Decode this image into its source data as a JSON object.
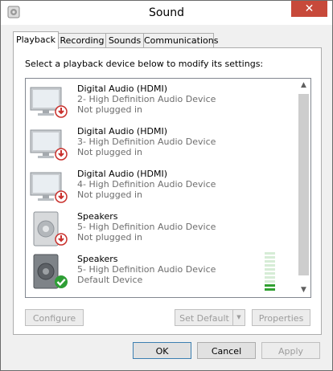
{
  "window": {
    "title": "Sound",
    "close_glyph": "✕"
  },
  "tabs": [
    {
      "label": "Playback"
    },
    {
      "label": "Recording"
    },
    {
      "label": "Sounds"
    },
    {
      "label": "Communications"
    }
  ],
  "playback": {
    "instruction": "Select a playback device below to modify its settings:",
    "devices": [
      {
        "name": "Digital Audio (HDMI)",
        "driver": "2- High Definition Audio Device",
        "status": "Not plugged in",
        "icon": "monitor-icon",
        "badge": "unplugged-badge-icon"
      },
      {
        "name": "Digital Audio (HDMI)",
        "driver": "3- High Definition Audio Device",
        "status": "Not plugged in",
        "icon": "monitor-icon",
        "badge": "unplugged-badge-icon"
      },
      {
        "name": "Digital Audio (HDMI)",
        "driver": "4- High Definition Audio Device",
        "status": "Not plugged in",
        "icon": "monitor-icon",
        "badge": "unplugged-badge-icon"
      },
      {
        "name": "Speakers",
        "driver": "5- High Definition Audio Device",
        "status": "Not plugged in",
        "icon": "speaker-icon",
        "badge": "unplugged-badge-icon"
      },
      {
        "name": "Speakers",
        "driver": "5- High Definition Audio Device",
        "status": "Default Device",
        "icon": "speaker-icon",
        "badge": "default-check-icon"
      }
    ],
    "default_device_level_bars_lit": 2,
    "default_device_level_bars_total": 10,
    "buttons": {
      "configure": "Configure",
      "set_default": "Set Default",
      "properties": "Properties"
    }
  },
  "dialog_buttons": {
    "ok": "OK",
    "cancel": "Cancel",
    "apply": "Apply"
  },
  "colors": {
    "close": "#c7493a",
    "default_check": "#2e9e35",
    "unplugged": "#c9302c"
  }
}
